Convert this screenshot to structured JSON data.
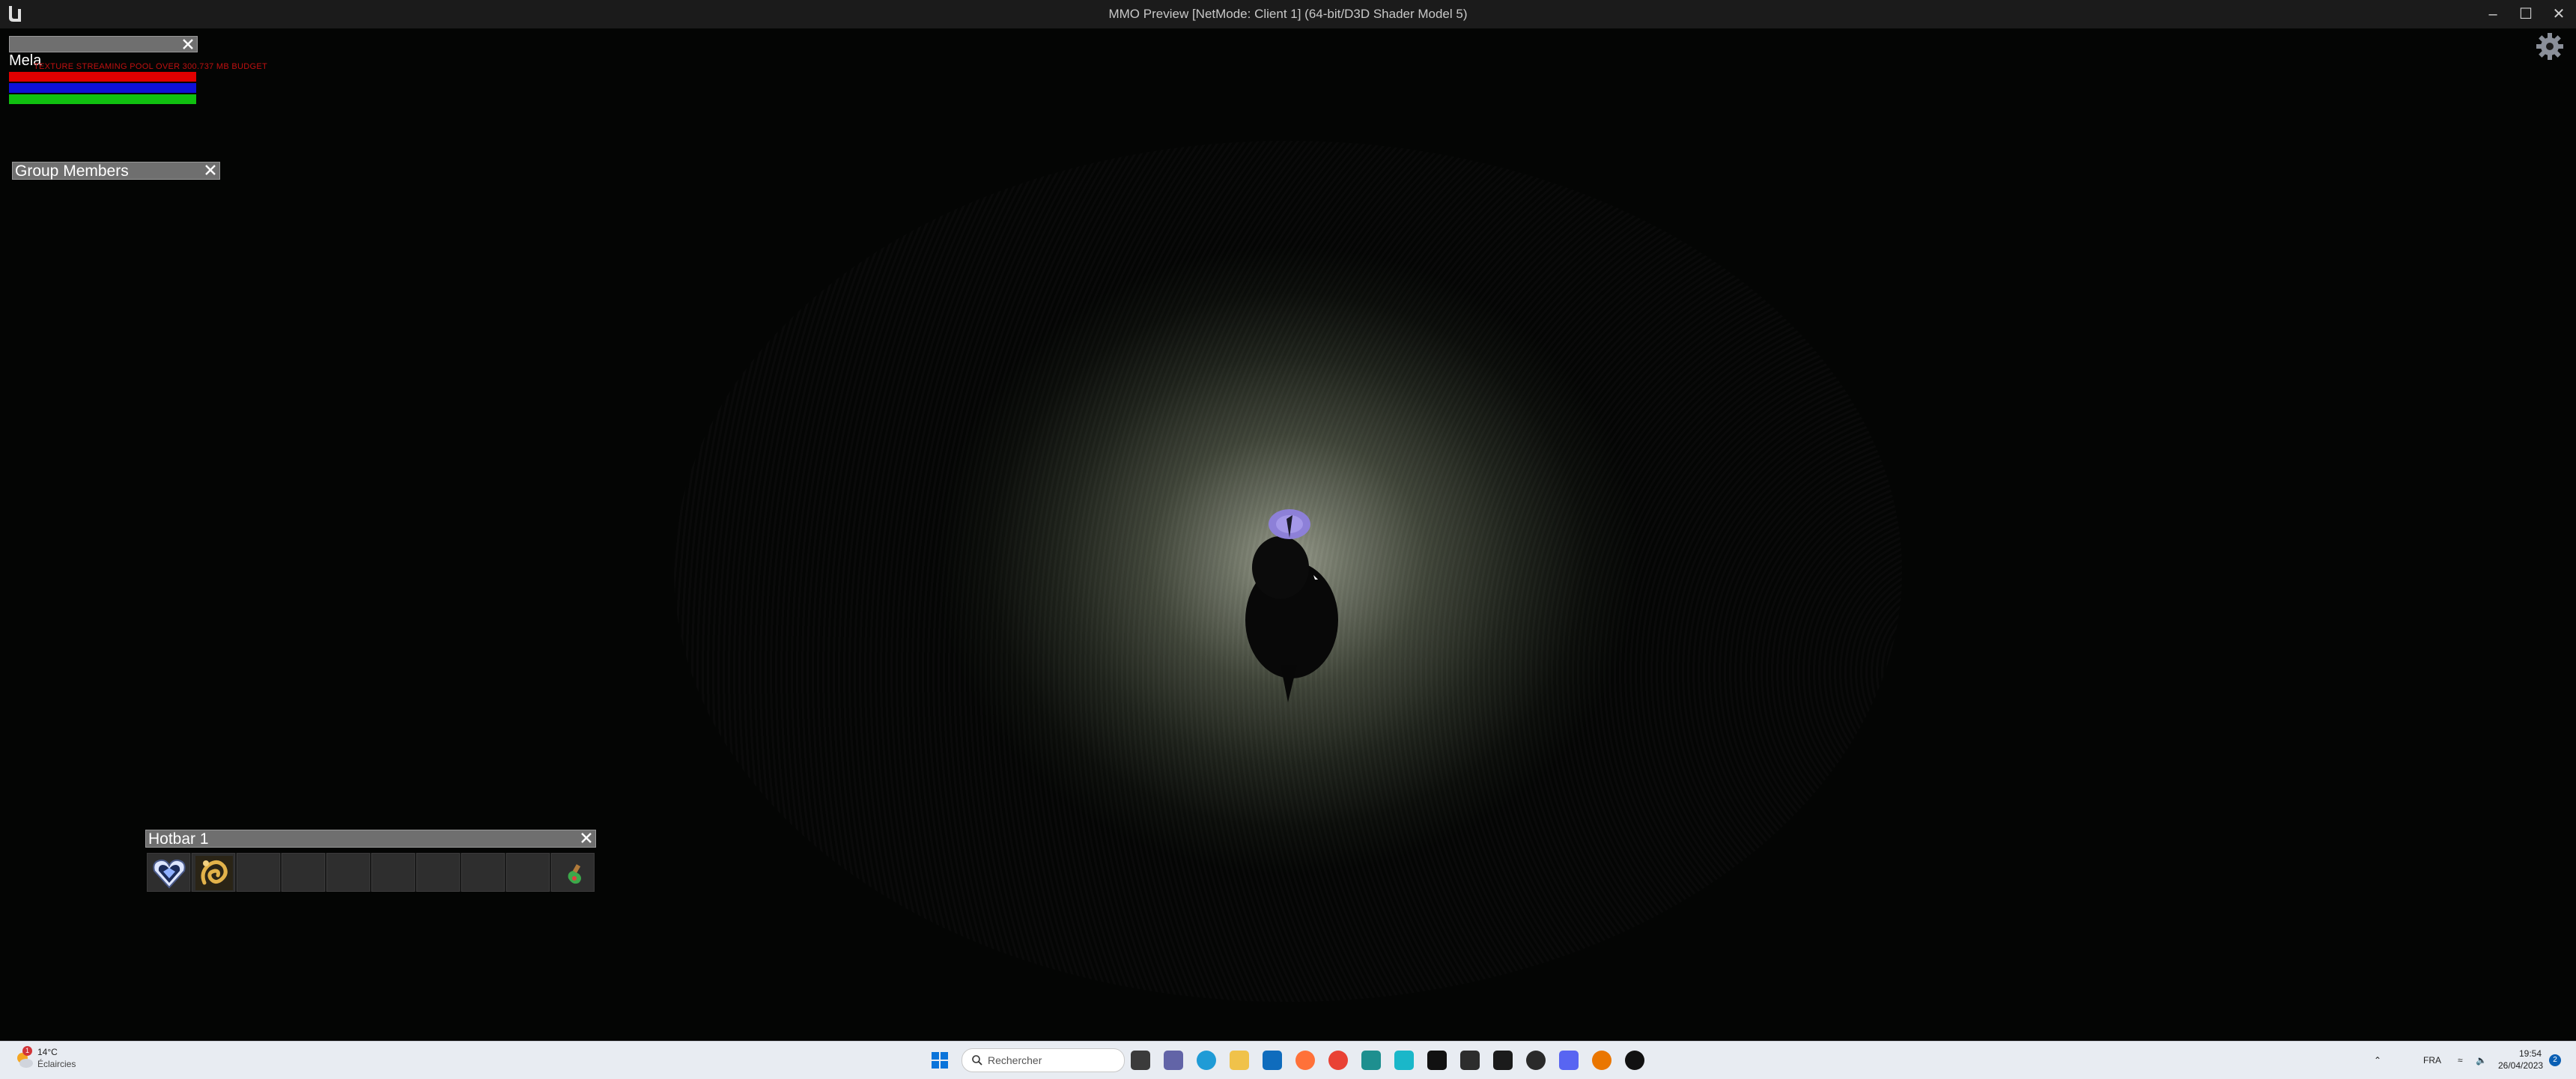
{
  "window": {
    "title": "MMO Preview [NetMode: Client 1]  (64-bit/D3D Shader Model 5)"
  },
  "hud": {
    "player_name": "Mela",
    "debug_message": "TEXTURE STREAMING POOL OVER 300.737 MB BUDGET",
    "bars": [
      {
        "name": "health",
        "color": "#e00000",
        "fill": 1.0
      },
      {
        "name": "mana",
        "color": "#1010d8",
        "fill": 1.0
      },
      {
        "name": "stamina",
        "color": "#10c010",
        "fill": 1.0
      }
    ],
    "group_panel": {
      "title": "Group Members"
    },
    "hotbar": {
      "title": "Hotbar 1",
      "slots": [
        {
          "icon": "heart-crystal-icon"
        },
        {
          "icon": "golden-swirl-icon"
        },
        {
          "icon": "empty"
        },
        {
          "icon": "empty"
        },
        {
          "icon": "empty"
        },
        {
          "icon": "empty"
        },
        {
          "icon": "empty"
        },
        {
          "icon": "empty"
        },
        {
          "icon": "empty"
        },
        {
          "icon": "potion-icon"
        }
      ]
    }
  },
  "taskbar": {
    "weather": {
      "temp": "14°C",
      "condition": "Éclaircies",
      "badge": "1"
    },
    "search_placeholder": "Rechercher",
    "pinned_apps": [
      "windows-start-icon",
      "search-icon",
      "file-explorer-icon",
      "teams-chat-icon",
      "edge-icon",
      "folder-icon",
      "mail-icon",
      "firefox-icon",
      "chrome-icon",
      "app-icon",
      "app-icon",
      "app-icon",
      "nvidia-icon",
      "app-icon",
      "app-icon",
      "discord-icon",
      "blender-icon",
      "unreal-icon"
    ],
    "tray": {
      "language": "FRA",
      "time": "19:54",
      "date": "26/04/2023",
      "notification_count": "2"
    }
  }
}
